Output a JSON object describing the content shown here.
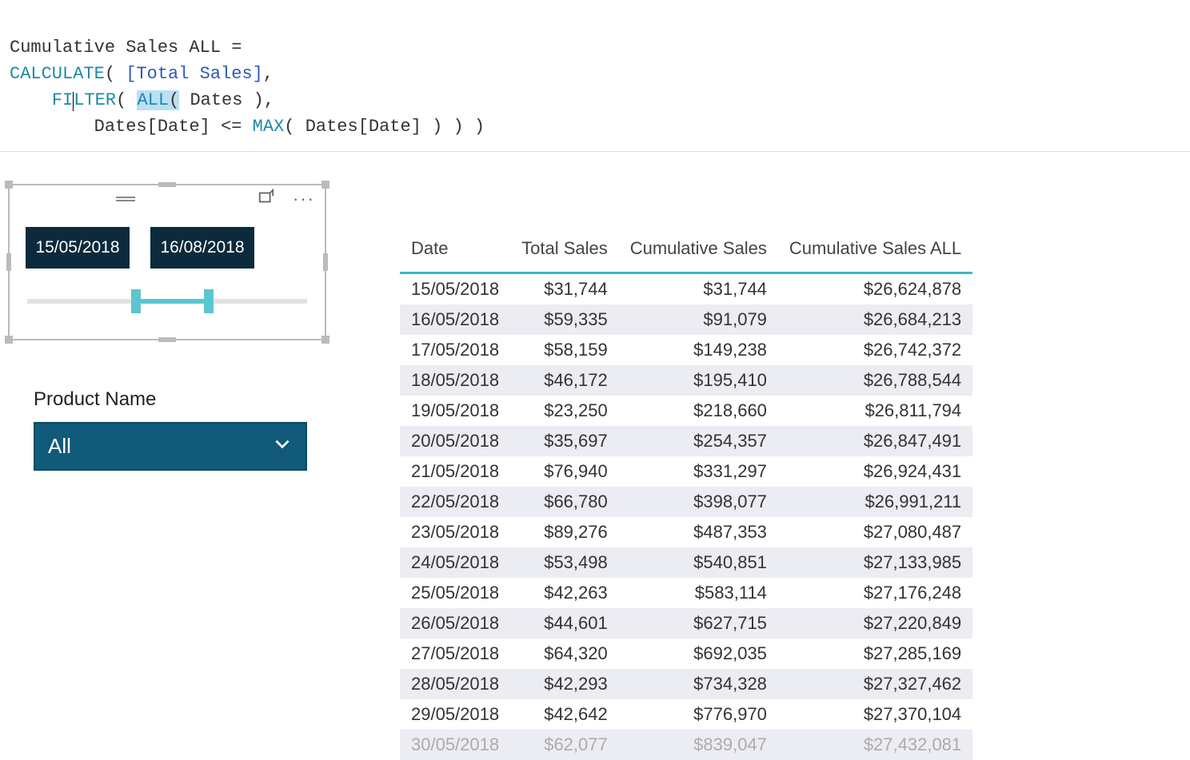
{
  "formula": {
    "measure_name": "Cumulative Sales ALL",
    "fn_calculate": "CALCULATE",
    "ref_total_sales": "[Total Sales]",
    "fn_filter": "FI",
    "fn_filter_mid": "L",
    "fn_filter_end": "TER",
    "fn_all": "ALL",
    "highlight_paren": "(",
    "tbl_dates": "Dates",
    "col_dates_date": "Dates[Date]",
    "op_lte": "<=",
    "fn_max": "MAX"
  },
  "slicer": {
    "start_date": "15/05/2018",
    "end_date": "16/08/2018",
    "fill_left_pct": 37,
    "fill_width_pct": 26
  },
  "product_filter": {
    "label": "Product Name",
    "selected": "All"
  },
  "table": {
    "headers": {
      "date": "Date",
      "total_sales": "Total Sales",
      "cumulative_sales": "Cumulative Sales",
      "cumulative_sales_all": "Cumulative Sales ALL"
    },
    "rows": [
      {
        "date": "15/05/2018",
        "total": "$31,744",
        "cum": "$31,744",
        "cum_all": "$26,624,878"
      },
      {
        "date": "16/05/2018",
        "total": "$59,335",
        "cum": "$91,079",
        "cum_all": "$26,684,213"
      },
      {
        "date": "17/05/2018",
        "total": "$58,159",
        "cum": "$149,238",
        "cum_all": "$26,742,372"
      },
      {
        "date": "18/05/2018",
        "total": "$46,172",
        "cum": "$195,410",
        "cum_all": "$26,788,544"
      },
      {
        "date": "19/05/2018",
        "total": "$23,250",
        "cum": "$218,660",
        "cum_all": "$26,811,794"
      },
      {
        "date": "20/05/2018",
        "total": "$35,697",
        "cum": "$254,357",
        "cum_all": "$26,847,491"
      },
      {
        "date": "21/05/2018",
        "total": "$76,940",
        "cum": "$331,297",
        "cum_all": "$26,924,431"
      },
      {
        "date": "22/05/2018",
        "total": "$66,780",
        "cum": "$398,077",
        "cum_all": "$26,991,211"
      },
      {
        "date": "23/05/2018",
        "total": "$89,276",
        "cum": "$487,353",
        "cum_all": "$27,080,487"
      },
      {
        "date": "24/05/2018",
        "total": "$53,498",
        "cum": "$540,851",
        "cum_all": "$27,133,985"
      },
      {
        "date": "25/05/2018",
        "total": "$42,263",
        "cum": "$583,114",
        "cum_all": "$27,176,248"
      },
      {
        "date": "26/05/2018",
        "total": "$44,601",
        "cum": "$627,715",
        "cum_all": "$27,220,849"
      },
      {
        "date": "27/05/2018",
        "total": "$64,320",
        "cum": "$692,035",
        "cum_all": "$27,285,169"
      },
      {
        "date": "28/05/2018",
        "total": "$42,293",
        "cum": "$734,328",
        "cum_all": "$27,327,462"
      },
      {
        "date": "29/05/2018",
        "total": "$42,642",
        "cum": "$776,970",
        "cum_all": "$27,370,104"
      },
      {
        "date": "30/05/2018",
        "total": "$62,077",
        "cum": "$839,047",
        "cum_all": "$27,432,081"
      }
    ]
  }
}
